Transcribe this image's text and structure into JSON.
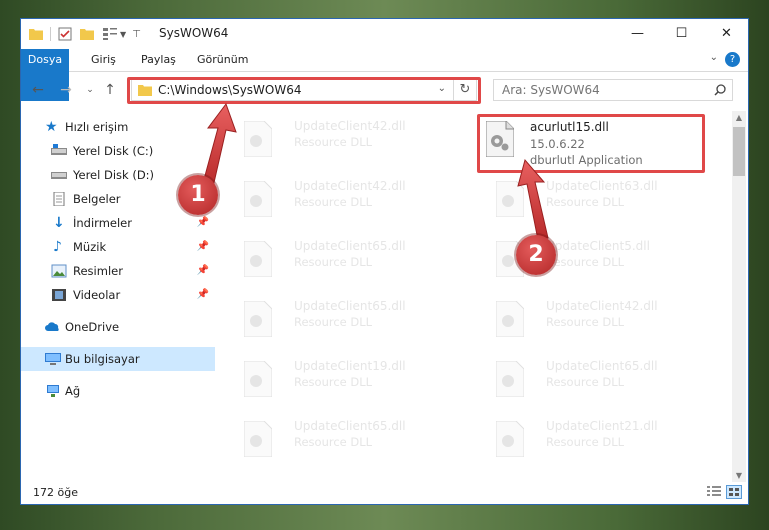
{
  "window": {
    "title": "SysWOW64",
    "controls": {
      "minimize": "—",
      "maximize": "☐",
      "close": "✕"
    }
  },
  "ribbon": {
    "tabs": [
      {
        "label": "Dosya"
      },
      {
        "label": "Giriş"
      },
      {
        "label": "Paylaş"
      },
      {
        "label": "Görünüm"
      }
    ]
  },
  "nav": {
    "address": "C:\\Windows\\SysWOW64",
    "search_placeholder": "Ara: SysWOW64"
  },
  "sidebar": {
    "items": [
      {
        "label": "Hızlı erişim",
        "icon": "star-icon"
      },
      {
        "label": "Yerel Disk (C:)",
        "icon": "drive-icon"
      },
      {
        "label": "Yerel Disk (D:)",
        "icon": "drive-icon"
      },
      {
        "label": "Belgeler",
        "icon": "documents-icon"
      },
      {
        "label": "İndirmeler",
        "icon": "download-icon"
      },
      {
        "label": "Müzik",
        "icon": "music-icon"
      },
      {
        "label": "Resimler",
        "icon": "pictures-icon"
      },
      {
        "label": "Videolar",
        "icon": "video-icon"
      },
      {
        "label": "OneDrive",
        "icon": "cloud-icon"
      },
      {
        "label": "Bu bilgisayar",
        "icon": "computer-icon"
      },
      {
        "label": "Ağ",
        "icon": "network-icon"
      }
    ]
  },
  "files": {
    "left": [
      {
        "name": "UpdateClient42.dll",
        "type": "Resource DLL"
      },
      {
        "name": "UpdateClient42.dll",
        "type": "Resource DLL"
      },
      {
        "name": "UpdateClient65.dll",
        "type": "Resource DLL"
      },
      {
        "name": "UpdateClient65.dll",
        "type": "Resource DLL"
      },
      {
        "name": "UpdateClient19.dll",
        "type": "Resource DLL"
      },
      {
        "name": "UpdateClient65.dll",
        "type": "Resource DLL"
      }
    ],
    "right": [
      {
        "name": "acurlutl15.dll",
        "version": "15.0.6.22",
        "type": "dburlutl Application"
      },
      {
        "name": "UpdateClient63.dll",
        "type": "Resource DLL"
      },
      {
        "name": "UpdateClient5.dll",
        "type": "Resource DLL"
      },
      {
        "name": "UpdateClient42.dll",
        "type": "Resource DLL"
      },
      {
        "name": "UpdateClient65.dll",
        "type": "Resource DLL"
      },
      {
        "name": "UpdateClient21.dll",
        "type": "Resource DLL"
      }
    ]
  },
  "status": {
    "count": "172 öğe"
  },
  "callouts": [
    "1",
    "2"
  ],
  "colors": {
    "accent": "#1979ca",
    "highlight": "#e04848",
    "selected": "#cde8ff"
  }
}
